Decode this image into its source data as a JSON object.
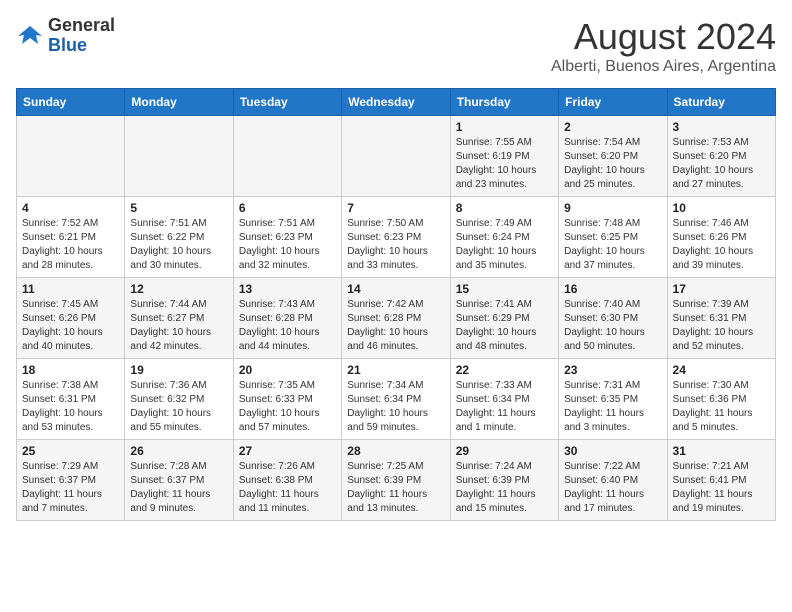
{
  "logo": {
    "general": "General",
    "blue": "Blue"
  },
  "header": {
    "month": "August 2024",
    "location": "Alberti, Buenos Aires, Argentina"
  },
  "weekdays": [
    "Sunday",
    "Monday",
    "Tuesday",
    "Wednesday",
    "Thursday",
    "Friday",
    "Saturday"
  ],
  "weeks": [
    [
      {
        "day": "",
        "info": ""
      },
      {
        "day": "",
        "info": ""
      },
      {
        "day": "",
        "info": ""
      },
      {
        "day": "",
        "info": ""
      },
      {
        "day": "1",
        "info": "Sunrise: 7:55 AM\nSunset: 6:19 PM\nDaylight: 10 hours\nand 23 minutes."
      },
      {
        "day": "2",
        "info": "Sunrise: 7:54 AM\nSunset: 6:20 PM\nDaylight: 10 hours\nand 25 minutes."
      },
      {
        "day": "3",
        "info": "Sunrise: 7:53 AM\nSunset: 6:20 PM\nDaylight: 10 hours\nand 27 minutes."
      }
    ],
    [
      {
        "day": "4",
        "info": "Sunrise: 7:52 AM\nSunset: 6:21 PM\nDaylight: 10 hours\nand 28 minutes."
      },
      {
        "day": "5",
        "info": "Sunrise: 7:51 AM\nSunset: 6:22 PM\nDaylight: 10 hours\nand 30 minutes."
      },
      {
        "day": "6",
        "info": "Sunrise: 7:51 AM\nSunset: 6:23 PM\nDaylight: 10 hours\nand 32 minutes."
      },
      {
        "day": "7",
        "info": "Sunrise: 7:50 AM\nSunset: 6:23 PM\nDaylight: 10 hours\nand 33 minutes."
      },
      {
        "day": "8",
        "info": "Sunrise: 7:49 AM\nSunset: 6:24 PM\nDaylight: 10 hours\nand 35 minutes."
      },
      {
        "day": "9",
        "info": "Sunrise: 7:48 AM\nSunset: 6:25 PM\nDaylight: 10 hours\nand 37 minutes."
      },
      {
        "day": "10",
        "info": "Sunrise: 7:46 AM\nSunset: 6:26 PM\nDaylight: 10 hours\nand 39 minutes."
      }
    ],
    [
      {
        "day": "11",
        "info": "Sunrise: 7:45 AM\nSunset: 6:26 PM\nDaylight: 10 hours\nand 40 minutes."
      },
      {
        "day": "12",
        "info": "Sunrise: 7:44 AM\nSunset: 6:27 PM\nDaylight: 10 hours\nand 42 minutes."
      },
      {
        "day": "13",
        "info": "Sunrise: 7:43 AM\nSunset: 6:28 PM\nDaylight: 10 hours\nand 44 minutes."
      },
      {
        "day": "14",
        "info": "Sunrise: 7:42 AM\nSunset: 6:28 PM\nDaylight: 10 hours\nand 46 minutes."
      },
      {
        "day": "15",
        "info": "Sunrise: 7:41 AM\nSunset: 6:29 PM\nDaylight: 10 hours\nand 48 minutes."
      },
      {
        "day": "16",
        "info": "Sunrise: 7:40 AM\nSunset: 6:30 PM\nDaylight: 10 hours\nand 50 minutes."
      },
      {
        "day": "17",
        "info": "Sunrise: 7:39 AM\nSunset: 6:31 PM\nDaylight: 10 hours\nand 52 minutes."
      }
    ],
    [
      {
        "day": "18",
        "info": "Sunrise: 7:38 AM\nSunset: 6:31 PM\nDaylight: 10 hours\nand 53 minutes."
      },
      {
        "day": "19",
        "info": "Sunrise: 7:36 AM\nSunset: 6:32 PM\nDaylight: 10 hours\nand 55 minutes."
      },
      {
        "day": "20",
        "info": "Sunrise: 7:35 AM\nSunset: 6:33 PM\nDaylight: 10 hours\nand 57 minutes."
      },
      {
        "day": "21",
        "info": "Sunrise: 7:34 AM\nSunset: 6:34 PM\nDaylight: 10 hours\nand 59 minutes."
      },
      {
        "day": "22",
        "info": "Sunrise: 7:33 AM\nSunset: 6:34 PM\nDaylight: 11 hours\nand 1 minute."
      },
      {
        "day": "23",
        "info": "Sunrise: 7:31 AM\nSunset: 6:35 PM\nDaylight: 11 hours\nand 3 minutes."
      },
      {
        "day": "24",
        "info": "Sunrise: 7:30 AM\nSunset: 6:36 PM\nDaylight: 11 hours\nand 5 minutes."
      }
    ],
    [
      {
        "day": "25",
        "info": "Sunrise: 7:29 AM\nSunset: 6:37 PM\nDaylight: 11 hours\nand 7 minutes."
      },
      {
        "day": "26",
        "info": "Sunrise: 7:28 AM\nSunset: 6:37 PM\nDaylight: 11 hours\nand 9 minutes."
      },
      {
        "day": "27",
        "info": "Sunrise: 7:26 AM\nSunset: 6:38 PM\nDaylight: 11 hours\nand 11 minutes."
      },
      {
        "day": "28",
        "info": "Sunrise: 7:25 AM\nSunset: 6:39 PM\nDaylight: 11 hours\nand 13 minutes."
      },
      {
        "day": "29",
        "info": "Sunrise: 7:24 AM\nSunset: 6:39 PM\nDaylight: 11 hours\nand 15 minutes."
      },
      {
        "day": "30",
        "info": "Sunrise: 7:22 AM\nSunset: 6:40 PM\nDaylight: 11 hours\nand 17 minutes."
      },
      {
        "day": "31",
        "info": "Sunrise: 7:21 AM\nSunset: 6:41 PM\nDaylight: 11 hours\nand 19 minutes."
      }
    ]
  ]
}
